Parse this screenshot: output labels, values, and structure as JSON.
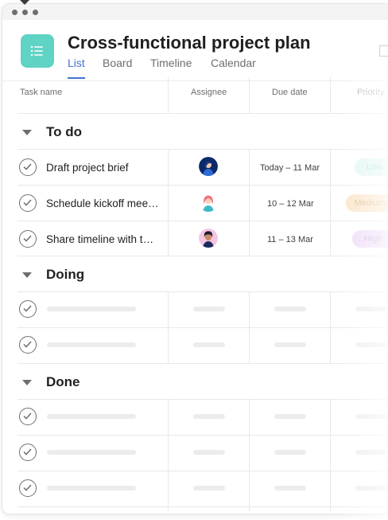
{
  "project": {
    "title": "Cross-functional project plan",
    "icon": "list-icon",
    "icon_color": "#5fd3c4"
  },
  "tabs": [
    {
      "label": "List",
      "active": true
    },
    {
      "label": "Board",
      "active": false
    },
    {
      "label": "Timeline",
      "active": false
    },
    {
      "label": "Calendar",
      "active": false
    }
  ],
  "columns": {
    "task_name": "Task name",
    "assignee": "Assignee",
    "due_date": "Due date",
    "priority": "Priority"
  },
  "sections": [
    {
      "title": "To do",
      "tasks": [
        {
          "name": "Draft project brief",
          "assignee": "avatar-blue",
          "due": "Today – 11 Mar",
          "priority": "Low"
        },
        {
          "name": "Schedule kickoff meeting",
          "assignee": "avatar-pink",
          "due": "10 – 12 Mar",
          "priority": "Medium"
        },
        {
          "name": "Share timeline with teammates",
          "assignee": "avatar-purple",
          "due": "11 – 13 Mar",
          "priority": "High"
        }
      ]
    },
    {
      "title": "Doing",
      "tasks": []
    },
    {
      "title": "Done",
      "tasks": []
    }
  ],
  "priority_colors": {
    "Low": {
      "bg": "#dff5f3",
      "fg": "#9ed9d2"
    },
    "Medium": {
      "bg": "#fbe3c4",
      "fg": "#d9b88a"
    },
    "High": {
      "bg": "#ecd9f5",
      "fg": "#c9a8dc"
    }
  },
  "accent": "#4573d2"
}
